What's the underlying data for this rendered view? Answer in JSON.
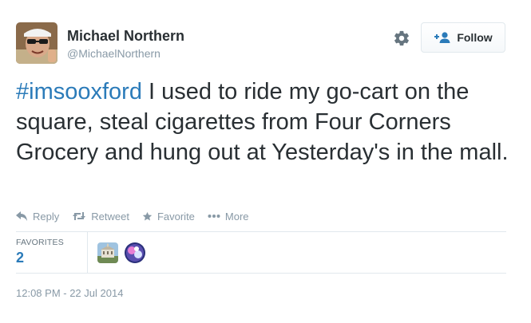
{
  "author": {
    "name": "Michael Northern",
    "handle": "@MichaelNorthern",
    "avatar_icon": "user-avatar-photo"
  },
  "header": {
    "settings_icon": "gear-icon",
    "follow_label": "Follow",
    "follow_icon": "add-user-icon"
  },
  "tweet": {
    "hashtag": "#imsooxford",
    "text": " I used to ride my go-cart on the square, steal cigarettes from Four Corners Grocery and hung out at Yesterday's in the mall."
  },
  "actions": [
    {
      "label": "Reply",
      "icon": "reply-icon"
    },
    {
      "label": "Retweet",
      "icon": "retweet-icon"
    },
    {
      "label": "Favorite",
      "icon": "star-icon"
    },
    {
      "label": "More",
      "icon": "more-dots-icon"
    }
  ],
  "stats": {
    "label": "FAVORITES",
    "count": "2"
  },
  "timestamp": "12:08 PM - 22 Jul 2014",
  "colors": {
    "link": "#2b7bb9",
    "muted": "#8899a6",
    "text": "#292f33",
    "border": "#e1e8ed"
  }
}
